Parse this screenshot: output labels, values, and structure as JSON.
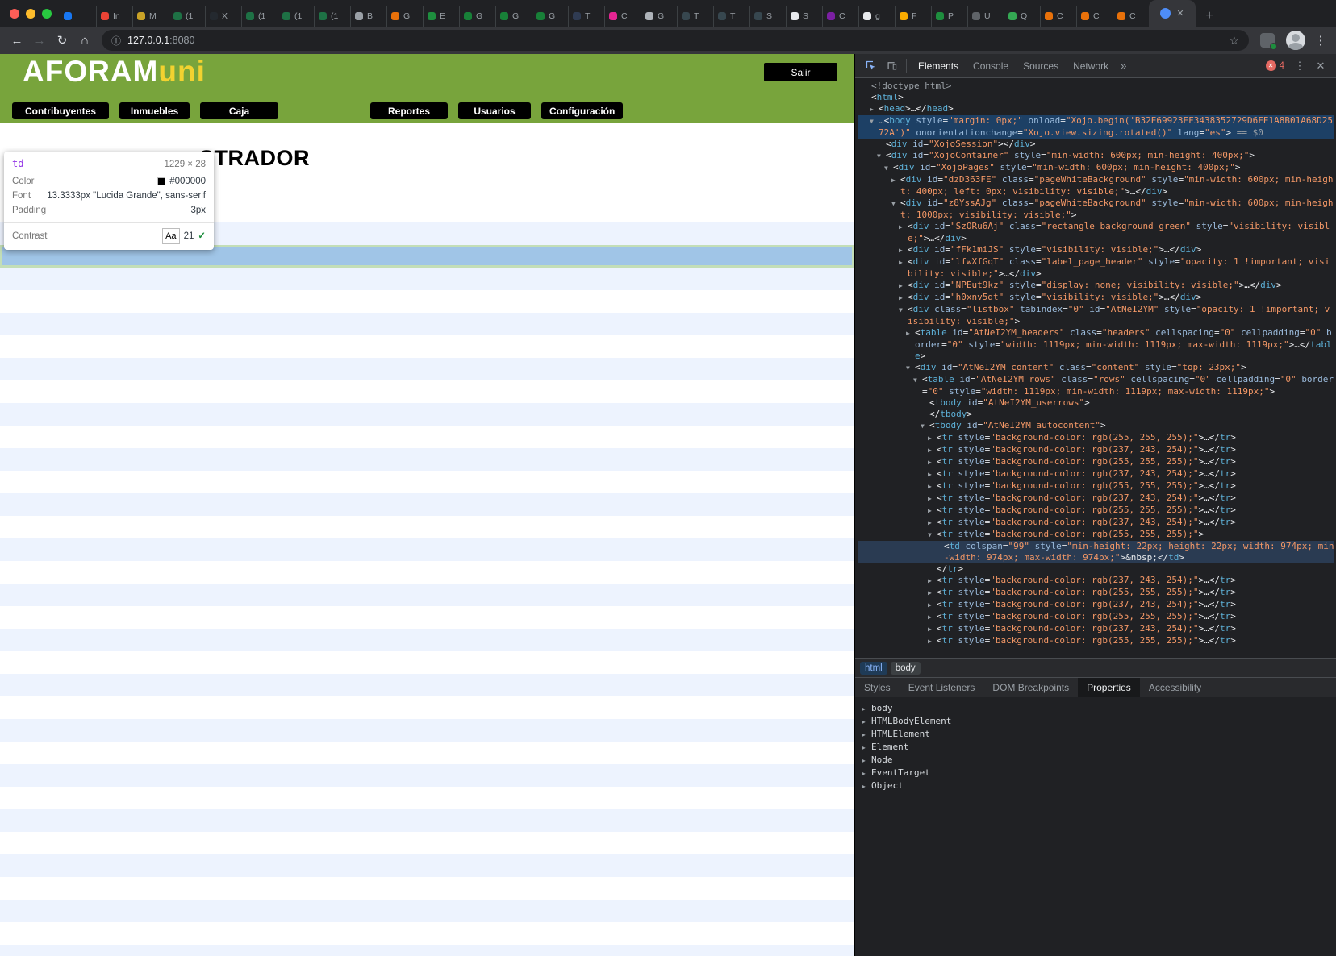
{
  "icons": {
    "back": "←",
    "forward": "→",
    "reload": "↻",
    "home": "⌂",
    "info": "ⓘ",
    "star": "☆",
    "close": "✕",
    "kebab": "⋮",
    "more": "»",
    "plus": "+",
    "collapsed": "▶",
    "expanded": "▼"
  },
  "browser": {
    "url_host": "127.0.0.1",
    "url_port": ":8080",
    "tabs": [
      {
        "l": "",
        "c": "#1877F2"
      },
      {
        "l": "In",
        "c": "#EA4335"
      },
      {
        "l": "M",
        "c": "#C9A227"
      },
      {
        "l": "(1",
        "c": "#1E7145"
      },
      {
        "l": "X",
        "c": "#24292F"
      },
      {
        "l": "(1",
        "c": "#1E7145"
      },
      {
        "l": "(1",
        "c": "#1E7145"
      },
      {
        "l": "(1",
        "c": "#1E7145"
      },
      {
        "l": "B",
        "c": "#9AA0A6"
      },
      {
        "l": "G",
        "c": "#E8710A"
      },
      {
        "l": "E",
        "c": "#1E8E3E"
      },
      {
        "l": "G",
        "c": "#188038"
      },
      {
        "l": "G",
        "c": "#188038"
      },
      {
        "l": "G",
        "c": "#188038"
      },
      {
        "l": "T",
        "c": "#2F3B52"
      },
      {
        "l": "C",
        "c": "#E52592"
      },
      {
        "l": "G",
        "c": "#AEB3B9"
      },
      {
        "l": "T",
        "c": "#37474F"
      },
      {
        "l": "T",
        "c": "#37474F"
      },
      {
        "l": "S",
        "c": "#37474F"
      },
      {
        "l": "S",
        "c": "#E8EAED"
      },
      {
        "l": "C",
        "c": "#7B1FA2"
      },
      {
        "l": "g",
        "c": "#E8EAED"
      },
      {
        "l": "F",
        "c": "#F9AB00"
      },
      {
        "l": "P",
        "c": "#1E8E3E"
      },
      {
        "l": "U",
        "c": "#5F6368"
      },
      {
        "l": "Q",
        "c": "#34A853"
      },
      {
        "l": "C",
        "c": "#E8710A"
      },
      {
        "l": "C",
        "c": "#E8710A"
      },
      {
        "l": "C",
        "c": "#E8710A"
      }
    ],
    "active_tab": {
      "color": "#4E8DF7"
    }
  },
  "app": {
    "logo_white": "AFORAM",
    "logo_accent": "uni",
    "logout": "Salir",
    "nav_left": [
      "Contribuyentes",
      "Inmuebles",
      "Caja"
    ],
    "nav_right": [
      "Reportes",
      "Usuarios",
      "Configuración"
    ],
    "title_visible": "STRADOR",
    "colors": {
      "header_green": "#78A43C",
      "accent_yellow": "#F2D230",
      "row_alt": "#EDF3FE",
      "highlight_content": "#A0C5E7",
      "highlight_padding": "#C3DEB7"
    }
  },
  "tooltip": {
    "tag": "td",
    "dimensions": "1229 × 28",
    "rows": [
      {
        "label": "Color",
        "value": "#000000",
        "swatch": "#000000"
      },
      {
        "label": "Font",
        "value": "13.3333px \"Lucida Grande\", sans-serif"
      },
      {
        "label": "Padding",
        "value": "3px"
      }
    ],
    "contrast_label": "Contrast",
    "contrast_sample": "Aa",
    "contrast_value": "21",
    "contrast_check": "✓"
  },
  "devtools": {
    "tabs": [
      "Elements",
      "Console",
      "Sources",
      "Network"
    ],
    "active_tab": "Elements",
    "error_count": "4",
    "crumbs": [
      "html",
      "body"
    ],
    "subtabs": [
      "Styles",
      "Event Listeners",
      "DOM Breakpoints",
      "Properties",
      "Accessibility"
    ],
    "active_subtab": "Properties",
    "properties": [
      "body",
      "HTMLBodyElement",
      "HTMLElement",
      "Element",
      "Node",
      "EventTarget",
      "Object"
    ],
    "tree": [
      {
        "i": 0,
        "m": 1,
        "t": "<!doctype html>"
      },
      {
        "i": 0,
        "t": "<html>"
      },
      {
        "i": 1,
        "a": "c",
        "t": "<head>…</head>"
      },
      {
        "i": 1,
        "a": "e",
        "sel": "body",
        "pre": "…",
        "t": "<body style=\"margin: 0px;\" onload=\"Xojo.begin('B32E69923EF3438352729D6FE1A8B01A68D2572A')\" onorientationchange=\"Xojo.view.sizing.rotated()\" lang=\"es\">",
        "suf": " == $0"
      },
      {
        "i": 2,
        "t": "<div id=\"XojoSession\"></div>"
      },
      {
        "i": 2,
        "a": "e",
        "t": "<div id=\"XojoContainer\" style=\"min-width: 600px; min-height: 400px;\">"
      },
      {
        "i": 3,
        "a": "e",
        "t": "<div id=\"XojoPages\" style=\"min-width: 600px; min-height: 400px;\">"
      },
      {
        "i": 4,
        "a": "c",
        "t": "<div id=\"dzD363FE\" class=\"pageWhiteBackground\" style=\"min-width: 600px; min-height: 400px; left: 0px; visibility: visible;\">…</div>"
      },
      {
        "i": 4,
        "a": "e",
        "t": "<div id=\"z8YssAJg\" class=\"pageWhiteBackground\" style=\"min-width: 600px; min-height: 1000px; visibility: visible;\">"
      },
      {
        "i": 5,
        "a": "c",
        "t": "<div id=\"SzORu6Aj\" class=\"rectangle_background_green\" style=\"visibility: visible;\">…</div>"
      },
      {
        "i": 5,
        "a": "c",
        "t": "<div id=\"fFk1miJS\" style=\"visibility: visible;\">…</div>"
      },
      {
        "i": 5,
        "a": "c",
        "t": "<div id=\"lfwXfGqT\" class=\"label_page_header\" style=\"opacity: 1 !important; visibility: visible;\">…</div>"
      },
      {
        "i": 5,
        "a": "c",
        "t": "<div id=\"NPEut9kz\" style=\"display: none; visibility: visible;\">…</div>"
      },
      {
        "i": 5,
        "a": "c",
        "t": "<div id=\"h0xnv5dt\" style=\"visibility: visible;\">…</div>"
      },
      {
        "i": 5,
        "a": "e",
        "t": "<div class=\"listbox\" tabindex=\"0\" id=\"AtNeI2YM\" style=\"opacity: 1 !important; visibility: visible;\">"
      },
      {
        "i": 6,
        "a": "c",
        "t": "<table id=\"AtNeI2YM_headers\" class=\"headers\" cellspacing=\"0\" cellpadding=\"0\" border=\"0\" style=\"width: 1119px; min-width: 1119px; max-width: 1119px;\">…</table>"
      },
      {
        "i": 6,
        "a": "e",
        "t": "<div id=\"AtNeI2YM_content\" class=\"content\" style=\"top: 23px;\">"
      },
      {
        "i": 7,
        "a": "e",
        "t": "<table id=\"AtNeI2YM_rows\" class=\"rows\" cellspacing=\"0\" cellpadding=\"0\" border=\"0\" style=\"width: 1119px; min-width: 1119px; max-width: 1119px;\">"
      },
      {
        "i": 8,
        "t": "<tbody id=\"AtNeI2YM_userrows\">"
      },
      {
        "i": 8,
        "t": "</tbody>"
      },
      {
        "i": 8,
        "a": "e",
        "t": "<tbody id=\"AtNeI2YM_autocontent\">"
      },
      {
        "i": 9,
        "a": "c",
        "t": "<tr style=\"background-color: rgb(255, 255, 255);\">…</tr>"
      },
      {
        "i": 9,
        "a": "c",
        "t": "<tr style=\"background-color: rgb(237, 243, 254);\">…</tr>"
      },
      {
        "i": 9,
        "a": "c",
        "t": "<tr style=\"background-color: rgb(255, 255, 255);\">…</tr>"
      },
      {
        "i": 9,
        "a": "c",
        "t": "<tr style=\"background-color: rgb(237, 243, 254);\">…</tr>"
      },
      {
        "i": 9,
        "a": "c",
        "t": "<tr style=\"background-color: rgb(255, 255, 255);\">…</tr>"
      },
      {
        "i": 9,
        "a": "c",
        "t": "<tr style=\"background-color: rgb(237, 243, 254);\">…</tr>"
      },
      {
        "i": 9,
        "a": "c",
        "t": "<tr style=\"background-color: rgb(255, 255, 255);\">…</tr>"
      },
      {
        "i": 9,
        "a": "c",
        "t": "<tr style=\"background-color: rgb(237, 243, 254);\">…</tr>"
      },
      {
        "i": 9,
        "a": "e",
        "t": "<tr style=\"background-color: rgb(255, 255, 255);\">"
      },
      {
        "i": 10,
        "sel": "td",
        "t": "<td colspan=\"99\" style=\"min-height: 22px; height: 22px; width: 974px; min-width: 974px; max-width: 974px;\">&nbsp;</td>"
      },
      {
        "i": 9,
        "t": "</tr>"
      },
      {
        "i": 9,
        "a": "c",
        "t": "<tr style=\"background-color: rgb(237, 243, 254);\">…</tr>"
      },
      {
        "i": 9,
        "a": "c",
        "t": "<tr style=\"background-color: rgb(255, 255, 255);\">…</tr>"
      },
      {
        "i": 9,
        "a": "c",
        "t": "<tr style=\"background-color: rgb(237, 243, 254);\">…</tr>"
      },
      {
        "i": 9,
        "a": "c",
        "t": "<tr style=\"background-color: rgb(255, 255, 255);\">…</tr>"
      },
      {
        "i": 9,
        "a": "c",
        "t": "<tr style=\"background-color: rgb(237, 243, 254);\">…</tr>"
      },
      {
        "i": 9,
        "a": "c",
        "t": "<tr style=\"background-color: rgb(255, 255, 255);\">…</tr>"
      }
    ]
  }
}
